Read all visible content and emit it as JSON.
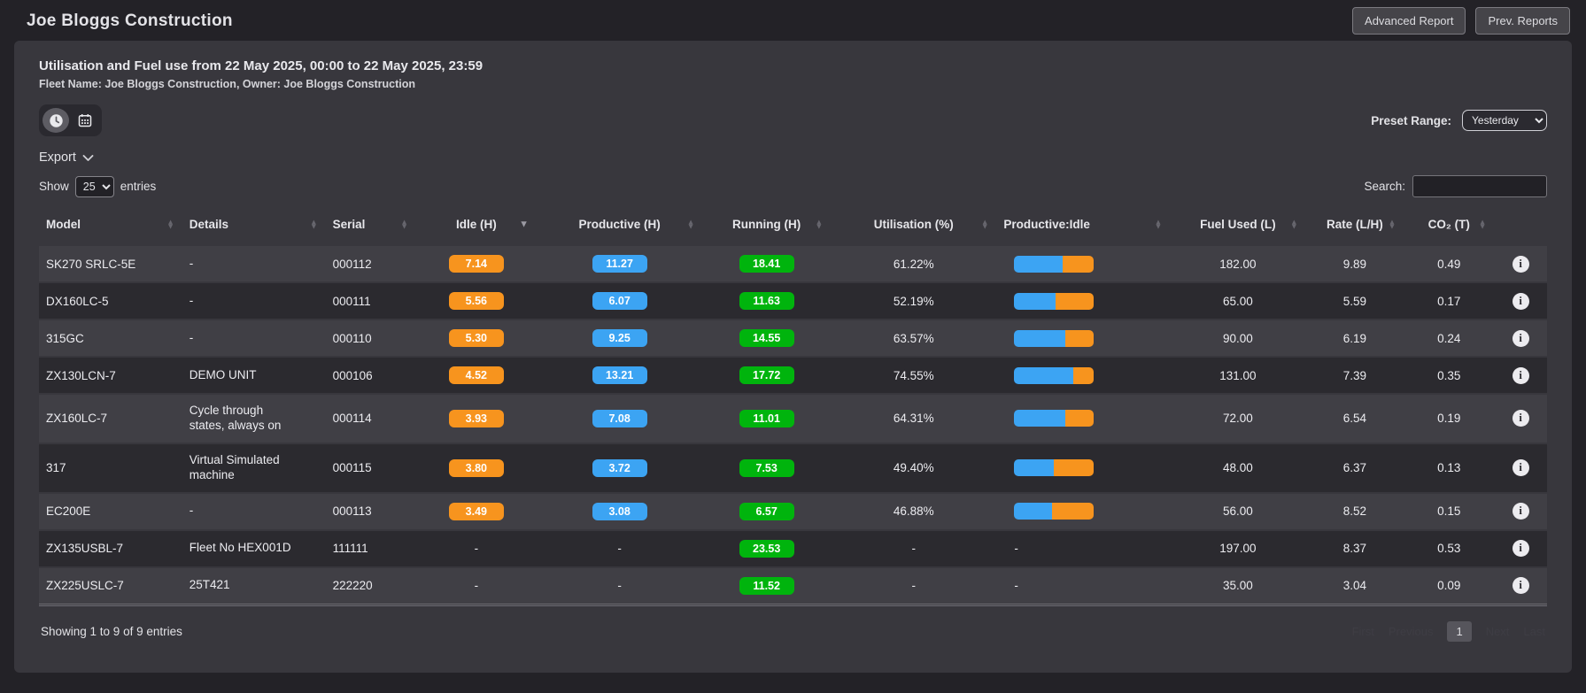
{
  "topbar": {
    "title": "Joe Bloggs Construction",
    "advanced_report_label": "Advanced Report",
    "prev_reports_label": "Prev. Reports"
  },
  "report": {
    "title": "Utilisation and Fuel use from 22 May 2025, 00:00 to 22 May 2025, 23:59",
    "subtitle": "Fleet Name: Joe Bloggs Construction, Owner: Joe Bloggs Construction",
    "preset_range_label": "Preset Range:",
    "preset_range_value": "Yesterday",
    "export_label": "Export",
    "show_label": "Show",
    "entries_label": "entries",
    "page_length_value": "25",
    "search_label": "Search:",
    "search_value": ""
  },
  "icons": [
    "clock-icon",
    "calendar-icon",
    "chevron-down-icon",
    "sort-icon",
    "info-icon"
  ],
  "glyphs": {
    "sort_asc": "▲",
    "sort_desc": "▼",
    "info": "i"
  },
  "colors": {
    "badge_idle": "#f7941e",
    "badge_productive": "#3ca4f3",
    "badge_running": "#00b40d",
    "bar_blue": "#3ca4f3",
    "bar_orange": "#f7941e"
  },
  "table": {
    "columns": [
      {
        "key": "model",
        "label": "Model",
        "sort": "both",
        "align": "left"
      },
      {
        "key": "details",
        "label": "Details",
        "sort": "both",
        "align": "left"
      },
      {
        "key": "serial",
        "label": "Serial",
        "sort": "both",
        "align": "left"
      },
      {
        "key": "idle",
        "label": "Idle (H)",
        "sort": "desc",
        "align": "center"
      },
      {
        "key": "productive",
        "label": "Productive (H)",
        "sort": "both",
        "align": "center"
      },
      {
        "key": "running",
        "label": "Running (H)",
        "sort": "both",
        "align": "center"
      },
      {
        "key": "utilisation",
        "label": "Utilisation (%)",
        "sort": "both",
        "align": "center"
      },
      {
        "key": "productive-idle",
        "label": "Productive:Idle",
        "sort": "both",
        "align": "left"
      },
      {
        "key": "fuel-used",
        "label": "Fuel Used (L)",
        "sort": "both",
        "align": "center"
      },
      {
        "key": "rate",
        "label": "Rate (L/H)",
        "sort": "both",
        "align": "center"
      },
      {
        "key": "co2",
        "label": "CO₂ (T)",
        "sort": "both",
        "align": "center"
      },
      {
        "key": "info",
        "label": "",
        "sort": "none",
        "align": "center"
      }
    ],
    "rows": [
      {
        "model": "SK270 SRLC-5E",
        "details": "-",
        "serial": "000112",
        "idle": "7.14",
        "productive": "11.27",
        "running": "18.41",
        "utilisation": "61.22%",
        "productive_idle_pct": 61.22,
        "fuel_used": "182.00",
        "rate": "9.89",
        "co2": "0.49"
      },
      {
        "model": "DX160LC-5",
        "details": "-",
        "serial": "000111",
        "idle": "5.56",
        "productive": "6.07",
        "running": "11.63",
        "utilisation": "52.19%",
        "productive_idle_pct": 52.19,
        "fuel_used": "65.00",
        "rate": "5.59",
        "co2": "0.17"
      },
      {
        "model": "315GC",
        "details": "-",
        "serial": "000110",
        "idle": "5.30",
        "productive": "9.25",
        "running": "14.55",
        "utilisation": "63.57%",
        "productive_idle_pct": 63.57,
        "fuel_used": "90.00",
        "rate": "6.19",
        "co2": "0.24"
      },
      {
        "model": "ZX130LCN-7",
        "details": "DEMO UNIT",
        "serial": "000106",
        "idle": "4.52",
        "productive": "13.21",
        "running": "17.72",
        "utilisation": "74.55%",
        "productive_idle_pct": 74.55,
        "fuel_used": "131.00",
        "rate": "7.39",
        "co2": "0.35"
      },
      {
        "model": "ZX160LC-7",
        "details": "Cycle through states, always on",
        "serial": "000114",
        "idle": "3.93",
        "productive": "7.08",
        "running": "11.01",
        "utilisation": "64.31%",
        "productive_idle_pct": 64.31,
        "fuel_used": "72.00",
        "rate": "6.54",
        "co2": "0.19"
      },
      {
        "model": "317",
        "details": "Virtual Simulated machine",
        "serial": "000115",
        "idle": "3.80",
        "productive": "3.72",
        "running": "7.53",
        "utilisation": "49.40%",
        "productive_idle_pct": 49.4,
        "fuel_used": "48.00",
        "rate": "6.37",
        "co2": "0.13"
      },
      {
        "model": "EC200E",
        "details": "-",
        "serial": "000113",
        "idle": "3.49",
        "productive": "3.08",
        "running": "6.57",
        "utilisation": "46.88%",
        "productive_idle_pct": 46.88,
        "fuel_used": "56.00",
        "rate": "8.52",
        "co2": "0.15"
      },
      {
        "model": "ZX135USBL-7",
        "details": "Fleet No HEX001D",
        "serial": "111111",
        "idle": "-",
        "productive": "-",
        "running": "23.53",
        "utilisation": "-",
        "productive_idle_pct": null,
        "fuel_used": "197.00",
        "rate": "8.37",
        "co2": "0.53"
      },
      {
        "model": "ZX225USLC-7",
        "details": "25T421",
        "serial": "222220",
        "idle": "-",
        "productive": "-",
        "running": "11.52",
        "utilisation": "-",
        "productive_idle_pct": null,
        "fuel_used": "35.00",
        "rate": "3.04",
        "co2": "0.09"
      }
    ],
    "footer": {
      "showing": "Showing 1 to 9 of 9 entries",
      "pagination": {
        "first": "First",
        "previous": "Previous",
        "current": "1",
        "next": "Next",
        "last": "Last"
      }
    }
  }
}
